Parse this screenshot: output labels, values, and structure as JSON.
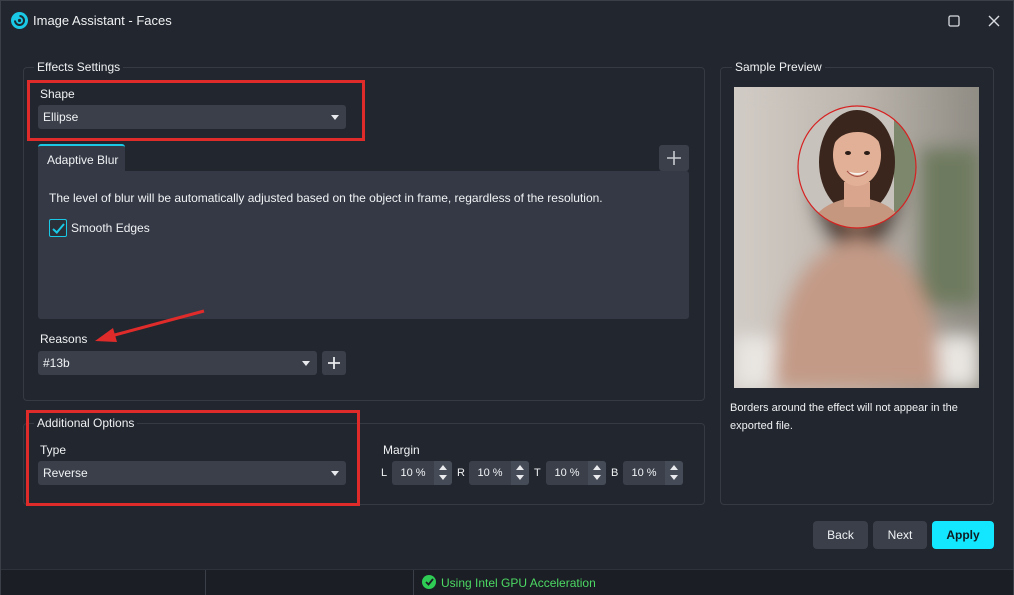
{
  "window": {
    "title": "Image Assistant - Faces"
  },
  "effects": {
    "group_label": "Effects Settings",
    "shape_label": "Shape",
    "shape_value": "Ellipse",
    "tab_label": "Adaptive Blur",
    "description": "The level of blur will be automatically adjusted based on the object in frame, regardless of the resolution.",
    "smooth_edges_label": "Smooth Edges",
    "smooth_edges_checked": true,
    "reasons_label": "Reasons",
    "reasons_value": "#13b"
  },
  "additional": {
    "group_label": "Additional Options",
    "type_label": "Type",
    "type_value": "Reverse",
    "margin_label": "Margin",
    "margins": [
      {
        "letter": "L",
        "value": "10 %"
      },
      {
        "letter": "R",
        "value": "10 %"
      },
      {
        "letter": "T",
        "value": "10 %"
      },
      {
        "letter": "B",
        "value": "10 %"
      }
    ]
  },
  "preview": {
    "group_label": "Sample Preview",
    "note": "Borders around the effect will not appear in the exported file."
  },
  "buttons": {
    "back": "Back",
    "next": "Next",
    "apply": "Apply"
  },
  "status": {
    "text": "Using Intel GPU Acceleration"
  },
  "colors": {
    "accent": "#13e6ff",
    "annotation": "#e02b2b",
    "status_ok": "#4cd964"
  },
  "icons": [
    "app-logo-icon",
    "maximize-icon",
    "close-icon",
    "chevron-down-icon",
    "plus-icon",
    "checkmark-icon",
    "status-check-icon"
  ]
}
